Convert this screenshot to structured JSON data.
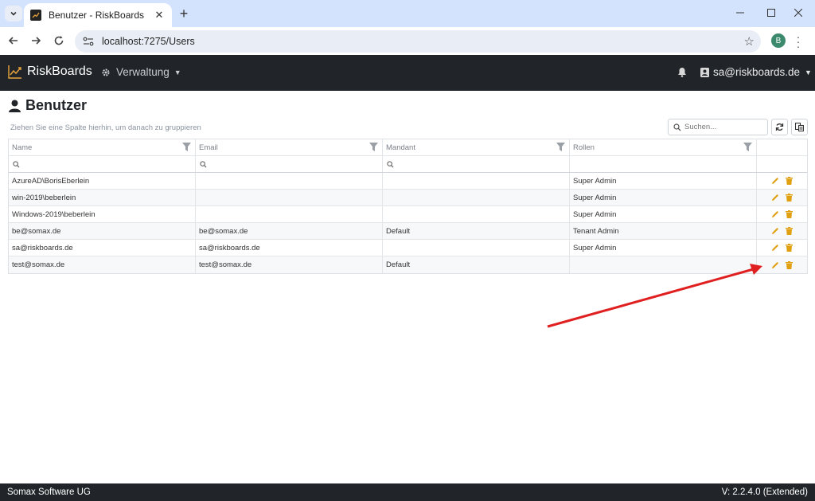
{
  "browser": {
    "tab_title": "Benutzer - RiskBoards",
    "url": "localhost:7275/Users",
    "profile_initial": "B"
  },
  "navbar": {
    "brand": "RiskBoards",
    "menu_label": "Verwaltung",
    "user_label": "sa@riskboards.de"
  },
  "page": {
    "title": "Benutzer",
    "group_hint": "Ziehen Sie eine Spalte hierhin, um danach zu gruppieren",
    "search_placeholder": "Suchen..."
  },
  "grid": {
    "columns": [
      "Name",
      "Email",
      "Mandant",
      "Rollen"
    ],
    "rows": [
      {
        "name": "AzureAD\\BorisEberlein",
        "email": "",
        "mandant": "",
        "rollen": "Super Admin"
      },
      {
        "name": "win-2019\\beberlein",
        "email": "",
        "mandant": "",
        "rollen": "Super Admin"
      },
      {
        "name": "Windows-2019\\beberlein",
        "email": "",
        "mandant": "",
        "rollen": "Super Admin"
      },
      {
        "name": "be@somax.de",
        "email": "be@somax.de",
        "mandant": "Default",
        "rollen": "Tenant Admin"
      },
      {
        "name": "sa@riskboards.de",
        "email": "sa@riskboards.de",
        "mandant": "",
        "rollen": "Super Admin"
      },
      {
        "name": "test@somax.de",
        "email": "test@somax.de",
        "mandant": "Default",
        "rollen": ""
      }
    ]
  },
  "footer": {
    "company": "Somax Software UG",
    "version": "V: 2.2.4.0 (Extended)"
  },
  "colors": {
    "navbar_bg": "#212529",
    "action_icon": "#e0a010",
    "annotation_arrow": "#e02020"
  }
}
